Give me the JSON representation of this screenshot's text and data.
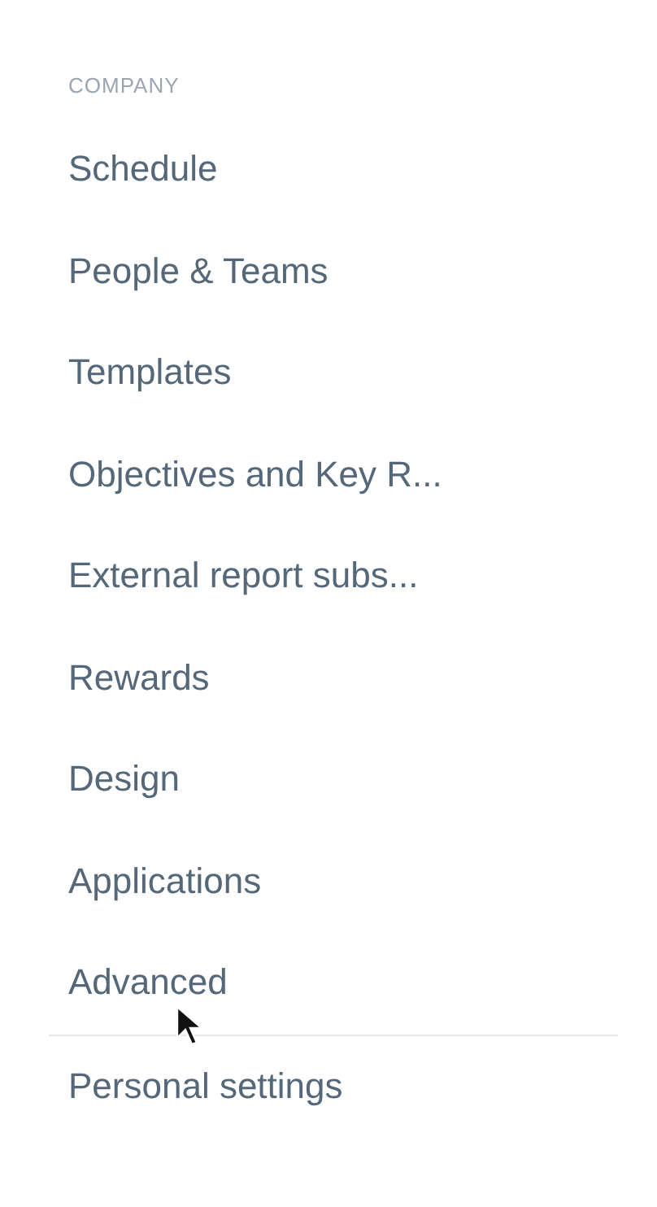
{
  "sidebar": {
    "section_title": "COMPANY",
    "items": [
      {
        "label": "Schedule"
      },
      {
        "label": "People & Teams"
      },
      {
        "label": "Templates"
      },
      {
        "label": "Objectives and Key R..."
      },
      {
        "label": "External report subs..."
      },
      {
        "label": "Rewards"
      },
      {
        "label": "Design"
      },
      {
        "label": "Applications"
      },
      {
        "label": "Advanced"
      }
    ],
    "footer_items": [
      {
        "label": "Personal settings"
      }
    ]
  }
}
